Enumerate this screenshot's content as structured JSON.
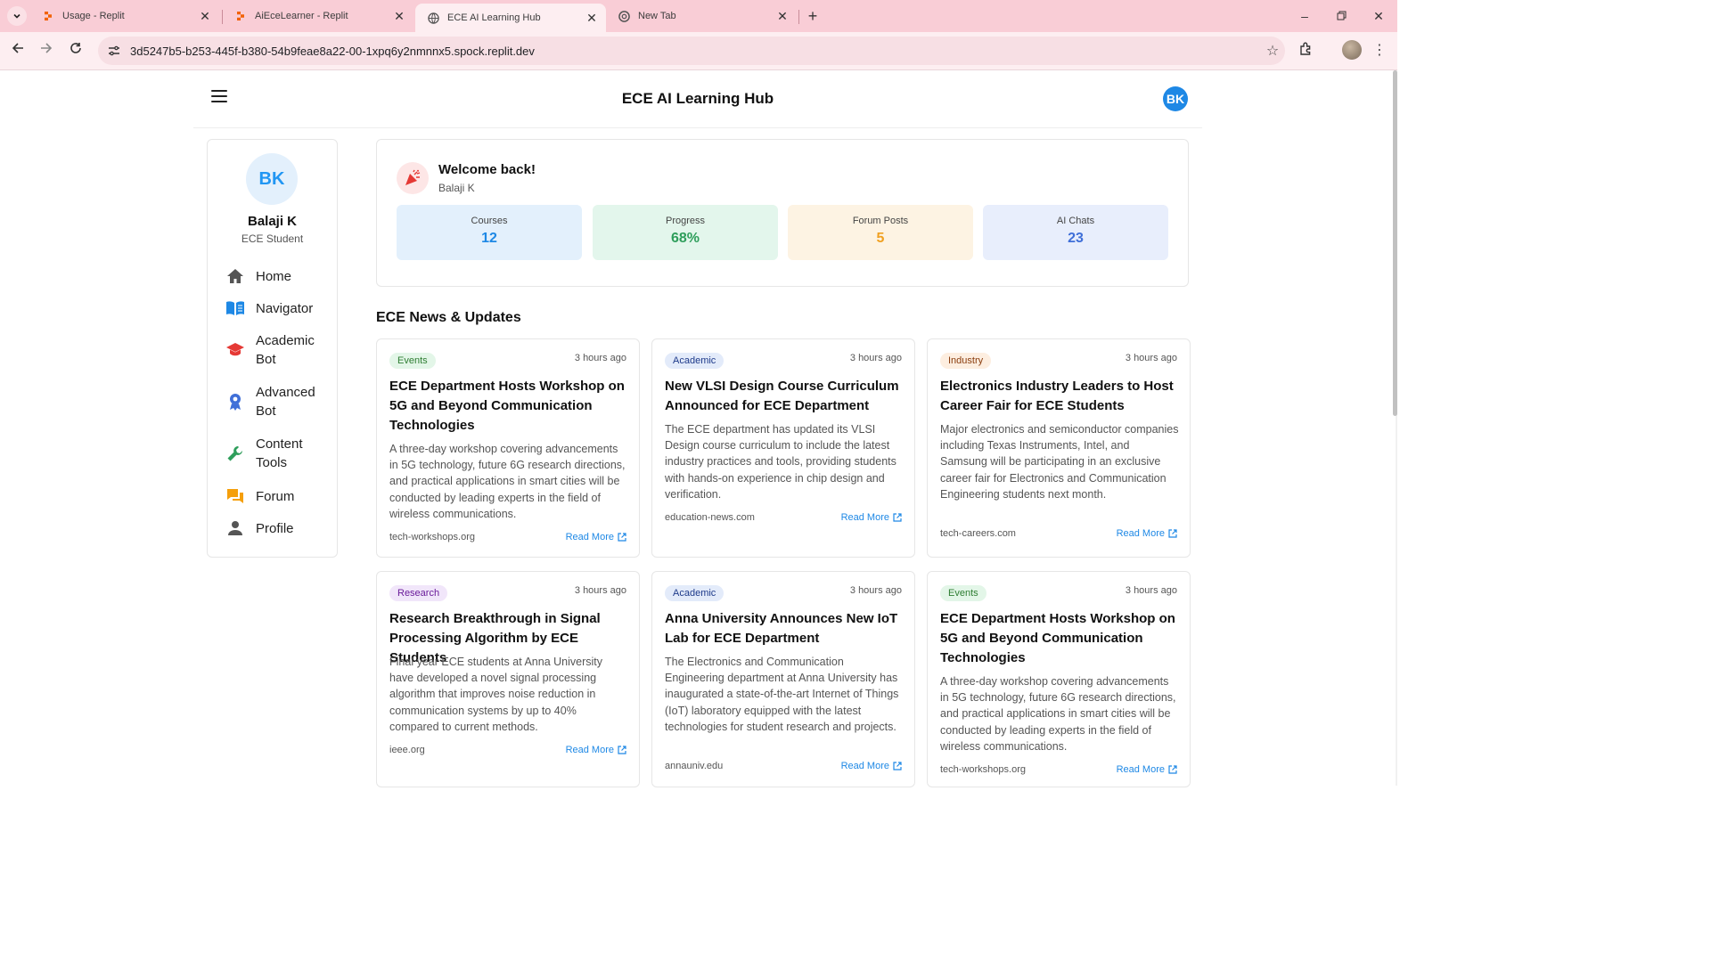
{
  "browser": {
    "tabs": [
      {
        "title": "Usage - Replit",
        "active": false
      },
      {
        "title": "AiEceLearner - Replit",
        "active": false
      },
      {
        "title": "ECE AI Learning Hub",
        "active": true
      },
      {
        "title": "New Tab",
        "active": false
      }
    ],
    "url": "3d5247b5-b253-445f-b380-54b9feae8a22-00-1xpq6y2nmnnx5.spock.replit.dev"
  },
  "header": {
    "title": "ECE AI Learning Hub",
    "avatar_initials": "BK"
  },
  "sidebar": {
    "avatar_initials": "BK",
    "name": "Balaji K",
    "role": "ECE Student",
    "items": [
      {
        "label": "Home",
        "icon": "home-icon"
      },
      {
        "label": "Navigator",
        "icon": "book-icon"
      },
      {
        "label": "Academic Bot",
        "icon": "graduation-cap-icon"
      },
      {
        "label": "Advanced Bot",
        "icon": "award-icon"
      },
      {
        "label": "Content Tools",
        "icon": "wrench-icon"
      },
      {
        "label": "Forum",
        "icon": "chat-bubbles-icon"
      },
      {
        "label": "Profile",
        "icon": "person-icon"
      }
    ]
  },
  "welcome": {
    "title": "Welcome back!",
    "subtitle": "Balaji K",
    "stats": [
      {
        "label": "Courses",
        "value": "12",
        "bg": "#e3f0fc",
        "color": "#1e88e5"
      },
      {
        "label": "Progress",
        "value": "68%",
        "bg": "#e3f6ec",
        "color": "#2e9e5b"
      },
      {
        "label": "Forum Posts",
        "value": "5",
        "bg": "#fdf3e3",
        "color": "#f0a020"
      },
      {
        "label": "AI Chats",
        "value": "23",
        "bg": "#e8eefc",
        "color": "#3f6fd8"
      }
    ]
  },
  "news": {
    "section_title": "ECE News & Updates",
    "read_more_label": "Read More",
    "cards": [
      {
        "category": "Events",
        "time": "3 hours ago",
        "title": "ECE Department Hosts Workshop on 5G and Beyond Communication Technologies",
        "description": "A three-day workshop covering advancements in 5G technology, future 6G research directions, and practical applications in smart cities will be conducted by leading experts in the field of wireless communications.",
        "source": "tech-workshops.org",
        "badge_bg": "#e3f6e8",
        "badge_color": "#2e7d32"
      },
      {
        "category": "Academic",
        "time": "3 hours ago",
        "title": "New VLSI Design Course Curriculum Announced for ECE Department",
        "description": "The ECE department has updated its VLSI Design course curriculum to include the latest industry practices and tools, providing students with hands-on experience in chip design and verification.",
        "source": "education-news.com",
        "badge_bg": "#e3ebfa",
        "badge_color": "#1e3a8a"
      },
      {
        "category": "Industry",
        "time": "3 hours ago",
        "title": "Electronics Industry Leaders to Host Career Fair for ECE Students",
        "description": "Major electronics and semiconductor companies including Texas Instruments, Intel, and Samsung will be participating in an exclusive career fair for Electronics and Communication Engineering students next month.",
        "source": "tech-careers.com",
        "badge_bg": "#fdeee0",
        "badge_color": "#8a3d0e"
      },
      {
        "category": "Research",
        "time": "3 hours ago",
        "title": "Research Breakthrough in Signal Processing Algorithm by ECE Students",
        "description": "Final year ECE students at Anna University have developed a novel signal processing algorithm that improves noise reduction in communication systems by up to 40% compared to current methods.",
        "source": "ieee.org",
        "badge_bg": "#f1e6fa",
        "badge_color": "#6a1b9a"
      },
      {
        "category": "Academic",
        "time": "3 hours ago",
        "title": "Anna University Announces New IoT Lab for ECE Department",
        "description": "The Electronics and Communication Engineering department at Anna University has inaugurated a state-of-the-art Internet of Things (IoT) laboratory equipped with the latest technologies for student research and projects.",
        "source": "annauniv.edu",
        "badge_bg": "#e3ebfa",
        "badge_color": "#1e3a8a"
      },
      {
        "category": "Events",
        "time": "3 hours ago",
        "title": "ECE Department Hosts Workshop on 5G and Beyond Communication Technologies",
        "description": "A three-day workshop covering advancements in 5G technology, future 6G research directions, and practical applications in smart cities will be conducted by leading experts in the field of wireless communications.",
        "source": "tech-workshops.org",
        "badge_bg": "#e3f6e8",
        "badge_color": "#2e7d32"
      }
    ]
  }
}
